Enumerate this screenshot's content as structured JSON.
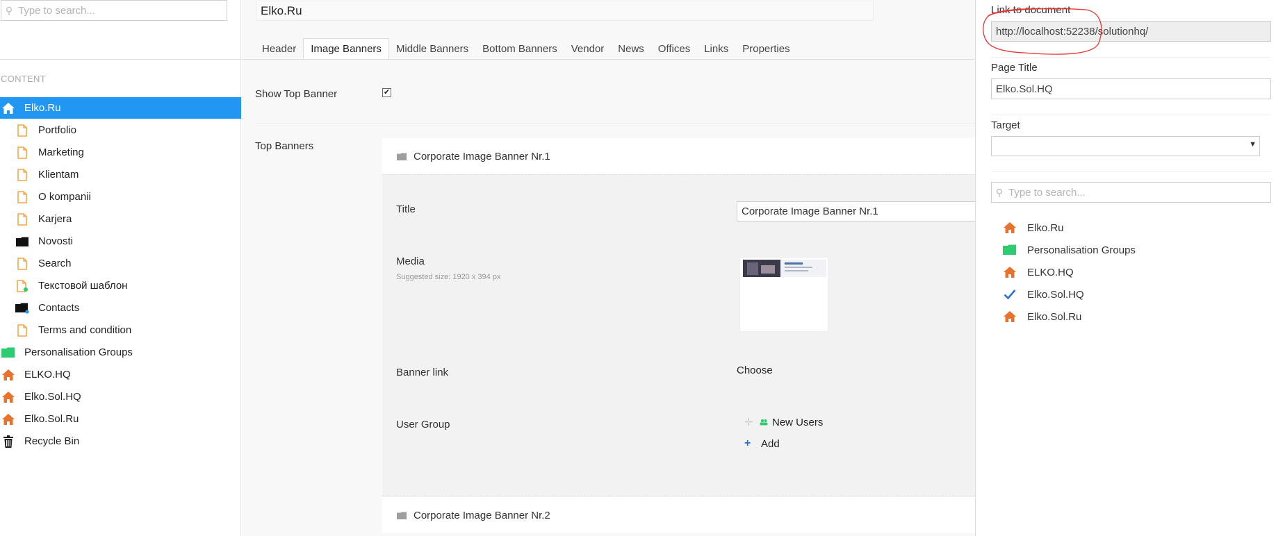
{
  "colors": {
    "accent": "#2196F3",
    "home_icon": "#E8712B",
    "doc_icon": "#F5A64A",
    "group_folder": "#2ECC71",
    "check": "#2D6FCF",
    "annotation": "#E53935"
  },
  "tree": {
    "search_placeholder": "Type to search...",
    "section_label": "CONTENT",
    "items": [
      {
        "label": "Elko.Ru",
        "icon": "home-icon",
        "selected": true
      },
      {
        "label": "Portfolio",
        "icon": "document-icon"
      },
      {
        "label": "Marketing",
        "icon": "document-icon"
      },
      {
        "label": "Klientam",
        "icon": "document-icon"
      },
      {
        "label": "O kompanii",
        "icon": "document-icon"
      },
      {
        "label": "Karjera",
        "icon": "document-icon"
      },
      {
        "label": "Novosti",
        "icon": "folder-icon"
      },
      {
        "label": "Search",
        "icon": "document-icon"
      },
      {
        "label": "Текстовой шаблон",
        "icon": "document-plus-icon"
      },
      {
        "label": "Contacts",
        "icon": "folder-icon"
      },
      {
        "label": "Terms and condition",
        "icon": "document-icon"
      },
      {
        "label": "Personalisation Groups",
        "icon": "green-folder-icon"
      },
      {
        "label": "ELKO.HQ",
        "icon": "home-icon"
      },
      {
        "label": "Elko.Sol.HQ",
        "icon": "home-icon"
      },
      {
        "label": "Elko.Sol.Ru",
        "icon": "home-icon"
      },
      {
        "label": "Recycle Bin",
        "icon": "trash-icon"
      }
    ]
  },
  "editor": {
    "node_name": "Elko.Ru",
    "tabs": [
      {
        "label": "Header"
      },
      {
        "label": "Image Banners",
        "active": true
      },
      {
        "label": "Middle Banners"
      },
      {
        "label": "Bottom Banners"
      },
      {
        "label": "Vendor"
      },
      {
        "label": "News"
      },
      {
        "label": "Offices"
      },
      {
        "label": "Links"
      },
      {
        "label": "Properties"
      }
    ],
    "show_top_banner_label": "Show Top Banner",
    "show_top_banner_checked": true,
    "top_banners_label": "Top Banners",
    "banners": [
      {
        "title": "Corporate Image Banner Nr.1"
      },
      {
        "title": "Corporate Image Banner Nr.2"
      }
    ],
    "banner_form": {
      "title_label": "Title",
      "title_value": "Corporate Image Banner Nr.1",
      "media_label": "Media",
      "media_hint": "Suggested size: 1920 x 394 px",
      "banner_link_label": "Banner link",
      "choose_label": "Choose",
      "user_group_label": "User Group",
      "user_group_item": "New Users",
      "add_label": "Add"
    }
  },
  "link_picker": {
    "link_label": "Link to document",
    "link_value": "http://localhost:52238/solutionhq/",
    "page_title_label": "Page Title",
    "page_title_value": "Elko.Sol.HQ",
    "target_label": "Target",
    "target_value": "",
    "search_placeholder": "Type to search...",
    "items": [
      {
        "label": "Elko.Ru",
        "icon": "home-icon"
      },
      {
        "label": "Personalisation Groups",
        "icon": "green-folder-icon"
      },
      {
        "label": "ELKO.HQ",
        "icon": "home-icon"
      },
      {
        "label": "Elko.Sol.HQ",
        "icon": "check-icon"
      },
      {
        "label": "Elko.Sol.Ru",
        "icon": "home-icon"
      }
    ]
  }
}
